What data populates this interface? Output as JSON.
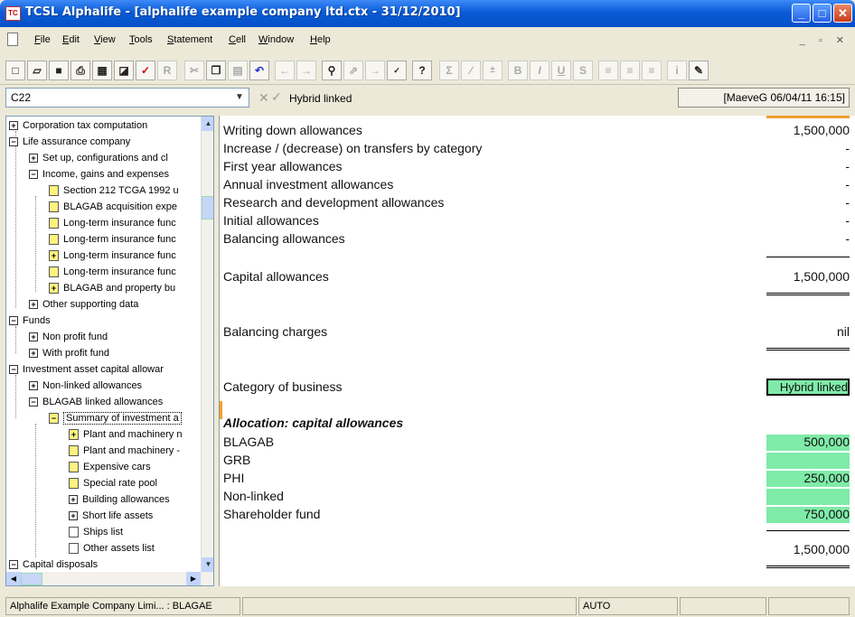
{
  "window": {
    "title": "TCSL Alphalife - [alphalife example company ltd.ctx - 31/12/2010]",
    "app_icon": "TC"
  },
  "menu": [
    "File",
    "Edit",
    "View",
    "Tools",
    "Statement",
    "Cell",
    "Window",
    "Help"
  ],
  "toolbar_icons": [
    "new-icon",
    "open-icon",
    "save-icon",
    "print-icon",
    "calculator-icon",
    "preview-icon",
    "check-icon",
    "r-icon",
    "cut-icon",
    "copy-icon",
    "paste-icon",
    "undo-icon",
    "back-icon",
    "forward-icon",
    "find-icon",
    "goto-icon",
    "next-icon",
    "spellcheck-icon",
    "help-icon",
    "sum-icon",
    "formula-icon",
    "plusminus-icon",
    "bold-icon",
    "italic-icon",
    "underline-icon",
    "s-icon",
    "align-left-icon",
    "align-center-icon",
    "align-right-icon",
    "info-icon",
    "notes-icon"
  ],
  "formula_bar": {
    "cell_ref": "C22",
    "value": "Hybrid linked",
    "timestamp": "[MaeveG 06/04/11 16:15]"
  },
  "tree": [
    {
      "label": "Corporation tax computation"
    },
    {
      "label": "Life assurance company"
    },
    {
      "label": "Set up, configurations and cl"
    },
    {
      "label": "Income, gains and expenses"
    },
    {
      "label": "Section 212 TCGA 1992 u"
    },
    {
      "label": "BLAGAB acquisition expe"
    },
    {
      "label": "Long-term insurance func"
    },
    {
      "label": "Long-term insurance func"
    },
    {
      "label": "Long-term insurance func"
    },
    {
      "label": "Long-term insurance func"
    },
    {
      "label": "BLAGAB and property bu"
    },
    {
      "label": "Other supporting data"
    },
    {
      "label": "Funds"
    },
    {
      "label": "Non profit fund"
    },
    {
      "label": "With profit fund"
    },
    {
      "label": "Investment asset capital allowar"
    },
    {
      "label": "Non-linked allowances"
    },
    {
      "label": "BLAGAB linked allowances"
    },
    {
      "label": "Summary of investment a"
    },
    {
      "label": "Plant and machinery n"
    },
    {
      "label": "Plant and machinery -"
    },
    {
      "label": "Expensive cars"
    },
    {
      "label": "Special rate pool"
    },
    {
      "label": "Building allowances"
    },
    {
      "label": "Short life assets"
    },
    {
      "label": "Ships list"
    },
    {
      "label": "Other assets list"
    },
    {
      "label": "Capital disposals"
    }
  ],
  "sheet": {
    "rows": [
      {
        "label": "Writing down allowances",
        "value": "1,500,000"
      },
      {
        "label": "Increase / (decrease) on transfers by category",
        "value": "-"
      },
      {
        "label": "First year allowances",
        "value": "-"
      },
      {
        "label": "Annual investment allowances",
        "value": "-"
      },
      {
        "label": "Research and development allowances",
        "value": "-"
      },
      {
        "label": "Initial allowances",
        "value": "-"
      },
      {
        "label": "Balancing allowances",
        "value": "-"
      }
    ],
    "capital_allowances": {
      "label": "Capital allowances",
      "value": "1,500,000"
    },
    "balancing_charges": {
      "label": "Balancing charges",
      "value": "nil"
    },
    "category": {
      "label": "Category of business",
      "value": "Hybrid linked"
    },
    "allocation_header": "Allocation: capital allowances",
    "allocation": [
      {
        "label": "BLAGAB",
        "value": "500,000"
      },
      {
        "label": "GRB",
        "value": ""
      },
      {
        "label": "PHI",
        "value": "250,000"
      },
      {
        "label": "Non-linked",
        "value": ""
      },
      {
        "label": "Shareholder fund",
        "value": "750,000"
      }
    ],
    "allocation_total": "1,500,000"
  },
  "status": {
    "company": "Alphalife Example Company Limi... : BLAGAE",
    "mode": "AUTO"
  }
}
